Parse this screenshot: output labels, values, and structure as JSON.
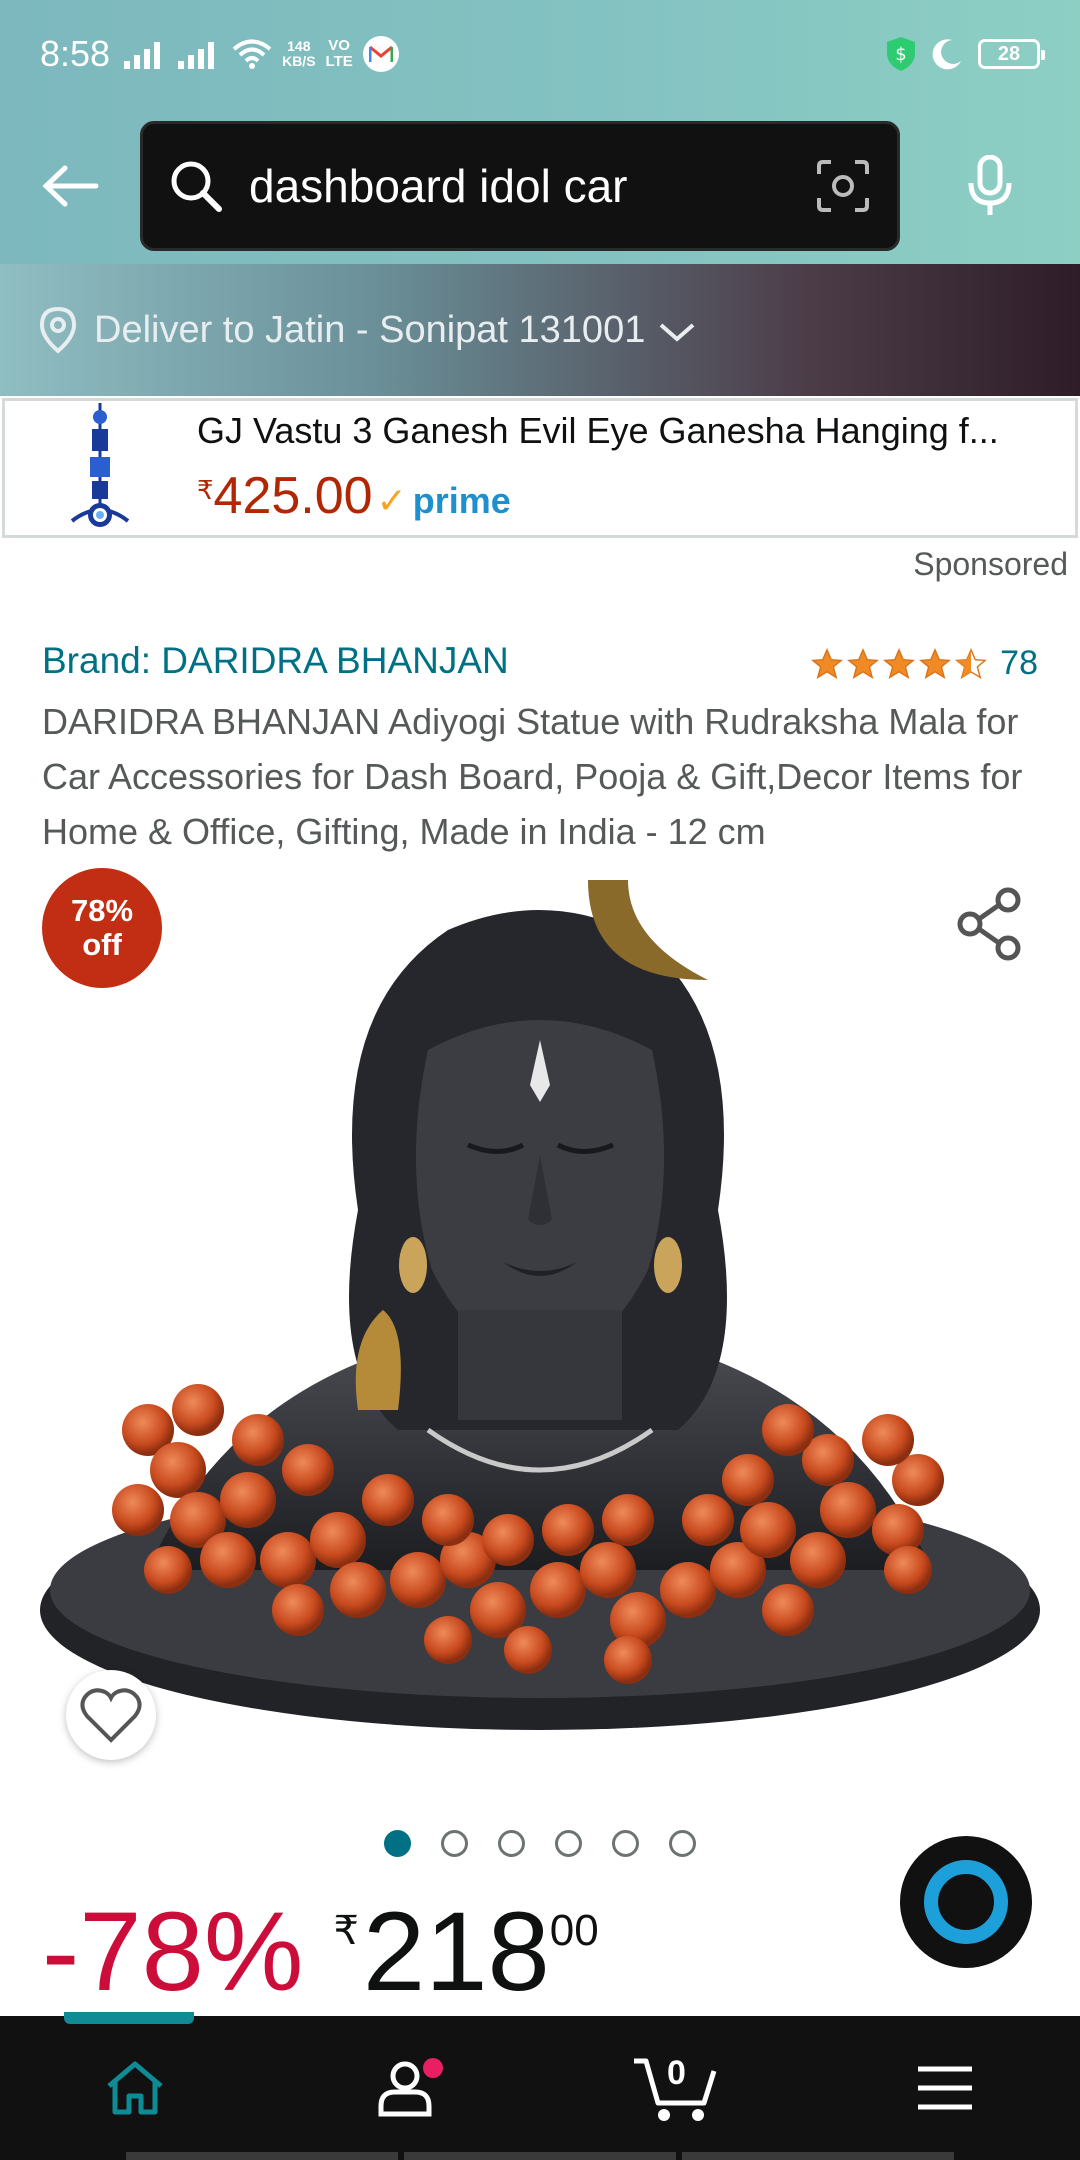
{
  "status_bar": {
    "time": "8:58",
    "net_speed_value": "148",
    "net_speed_unit": "KB/S",
    "volte_top": "VO",
    "volte_bottom": "LTE",
    "battery": "28"
  },
  "search": {
    "query": "dashboard idol car"
  },
  "deliver": {
    "text": "Deliver to Jatin - Sonipat 131001"
  },
  "ad": {
    "title": "GJ Vastu 3 Ganesh Evil Eye Ganesha Hanging f...",
    "currency_symbol": "₹",
    "price": "425.00",
    "prime_label": "prime",
    "sponsored_label": "Sponsored"
  },
  "product": {
    "brand": "Brand: DARIDRA BHANJAN",
    "rating_value": 4.5,
    "rating_count": "78",
    "title": "DARIDRA BHANJAN Adiyogi Statue with Rudraksha Mala for Car Accessories for Dash Board, Pooja & Gift,Decor Items for Home & Office, Gifting, Made in India - 12 cm",
    "badge_line1": "78%",
    "badge_line2": "off",
    "image_count": 6,
    "active_image_index": 0,
    "discount_label": "-78%",
    "currency_symbol": "₹",
    "price_whole": "218",
    "price_fraction": "00"
  },
  "bottom_nav": {
    "cart_count": "0",
    "items": [
      "home-icon",
      "account-icon",
      "cart-icon",
      "menu-icon"
    ]
  },
  "colors": {
    "link": "#007185",
    "price_red": "#b12704",
    "discount_red": "#cc0c39",
    "badge_red": "#c12e13",
    "prime_blue": "#1f8fce",
    "star_orange": "#f08a24",
    "nav_accent": "#0f8b96"
  }
}
